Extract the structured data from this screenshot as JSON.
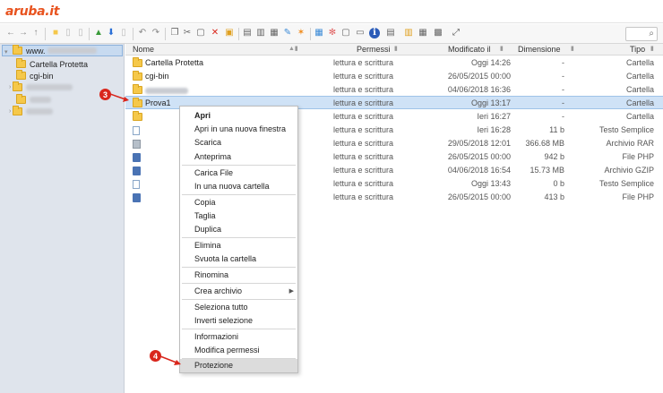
{
  "app": {
    "logo": "aruba.it"
  },
  "toolbar": {
    "icons": [
      "arrow-left-icon",
      "arrow-right-icon",
      "arrow-up-icon",
      "new-folder-icon",
      "new-file-icon",
      "new-doc-icon",
      "upload-icon",
      "download-icon",
      "file-icon",
      "undo-icon",
      "redo-icon",
      "copy-icon",
      "cut-icon",
      "paste-icon",
      "delete-icon",
      "duplicate-icon",
      "extract-icon",
      "archive-icon",
      "rename-icon",
      "edit-icon",
      "star-icon",
      "grid-icon",
      "settings-icon",
      "select-icon",
      "view-icon",
      "info-icon",
      "permissions-icon",
      "tree-icon",
      "list-icon",
      "fullscreen-icon"
    ],
    "search_placeholder": ""
  },
  "sidebar": {
    "root_label": "www.",
    "items": [
      {
        "label": "Cartella Protetta"
      },
      {
        "label": "cgi-bin"
      }
    ]
  },
  "list": {
    "headers": {
      "name": "Nome",
      "perms": "Permessi",
      "modified": "Modificato il",
      "size": "Dimensione",
      "type": "Tipo"
    },
    "rows": [
      {
        "name": "Cartella Protetta",
        "perms": "lettura e scrittura",
        "modified": "Oggi 14:26",
        "size": "-",
        "type": "Cartella"
      },
      {
        "name": "cgi-bin",
        "perms": "lettura e scrittura",
        "modified": "26/05/2015 00:00",
        "size": "-",
        "type": "Cartella"
      },
      {
        "name": "",
        "perms": "lettura e scrittura",
        "modified": "04/06/2018 16:36",
        "size": "-",
        "type": "Cartella"
      },
      {
        "name": "Prova1",
        "perms": "lettura e scrittura",
        "modified": "Oggi 13:17",
        "size": "-",
        "type": "Cartella"
      },
      {
        "name": "",
        "perms": "lettura e scrittura",
        "modified": "Ieri 16:27",
        "size": "-",
        "type": "Cartella"
      },
      {
        "name": "",
        "perms": "lettura e scrittura",
        "modified": "Ieri 16:28",
        "size": "11 b",
        "type": "Testo Semplice"
      },
      {
        "name": "",
        "perms": "lettura e scrittura",
        "modified": "29/05/2018 12:01",
        "size": "366.68 MB",
        "type": "Archivio RAR"
      },
      {
        "name": "",
        "perms": "lettura e scrittura",
        "modified": "26/05/2015 00:00",
        "size": "942 b",
        "type": "File PHP"
      },
      {
        "name": "",
        "perms": "lettura e scrittura",
        "modified": "04/06/2018 16:54",
        "size": "15.73 MB",
        "type": "Archivio GZIP"
      },
      {
        "name": "",
        "perms": "lettura e scrittura",
        "modified": "Oggi 13:43",
        "size": "0 b",
        "type": "Testo Semplice"
      },
      {
        "name": "",
        "perms": "lettura e scrittura",
        "modified": "26/05/2015 00:00",
        "size": "413 b",
        "type": "File PHP"
      }
    ]
  },
  "context_menu": {
    "items": [
      "Apri",
      "Apri in una nuova finestra",
      "Scarica",
      "Anteprima",
      "Carica File",
      "In una nuova cartella",
      "Copia",
      "Taglia",
      "Duplica",
      "Elimina",
      "Svuota la cartella",
      "Rinomina",
      "Crea archivio",
      "Seleziona tutto",
      "Inverti selezione",
      "Informazioni",
      "Modifica permessi",
      "Protezione"
    ]
  },
  "markers": {
    "m3": "3",
    "m4": "4"
  },
  "colors": {
    "accent": "#e8531f",
    "selection": "#cfe2f6",
    "sidebar": "#dfe4ec",
    "marker": "#d9261c"
  }
}
